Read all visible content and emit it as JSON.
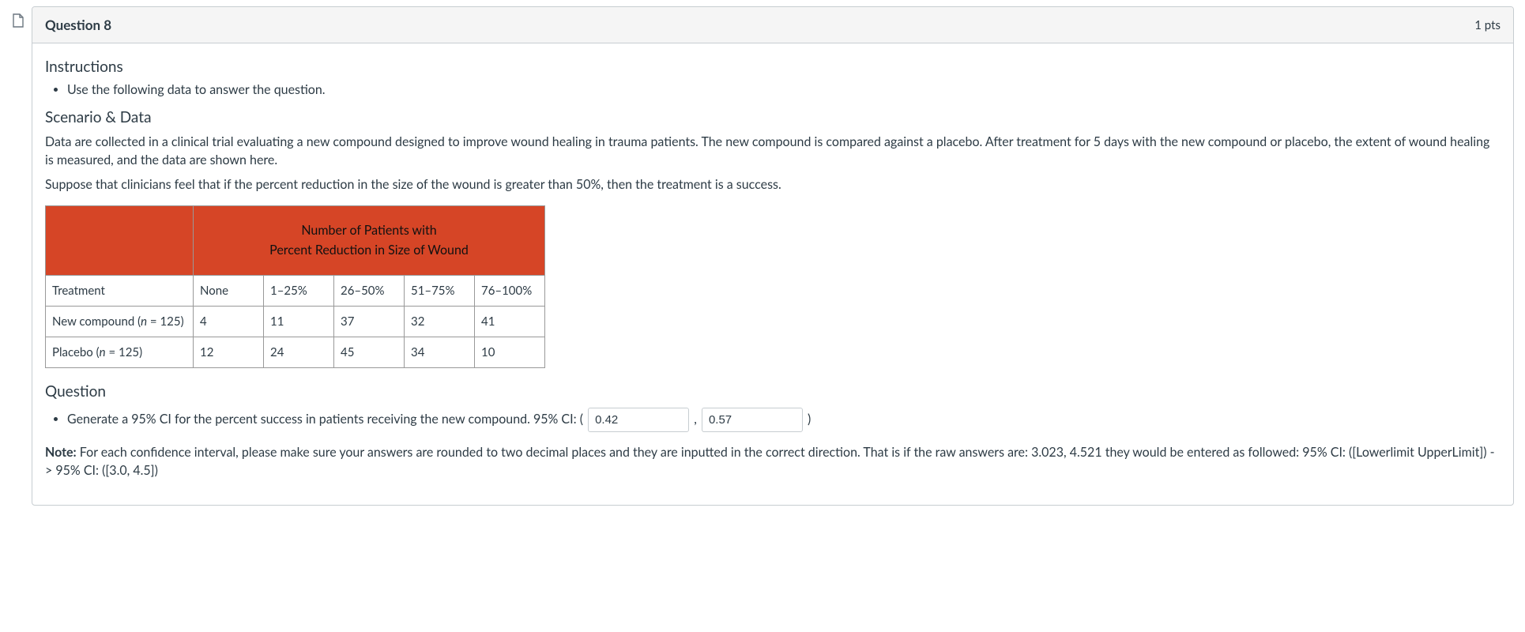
{
  "header": {
    "title": "Question 8",
    "points": "1 pts"
  },
  "sections": {
    "instructions_h": "Instructions",
    "instructions_item": "Use the following data to answer the question.",
    "scenario_h": "Scenario & Data",
    "scenario_p1": "Data are collected in a clinical trial evaluating a new compound designed to improve wound healing in trauma patients. The new compound is compared against a placebo. After treatment for 5 days with the new compound or placebo, the extent of wound healing is measured, and the data are shown here.",
    "scenario_p2": "Suppose that clinicians feel that if the percent reduction in the size of the wound is greater than 50%, then the treatment is a success.",
    "question_h": "Question",
    "question_text_a": "Generate a 95% CI for the percent success in patients receiving the new compound. 95% CI: (",
    "comma": ",",
    "close_paren": ")",
    "note_label": "Note:",
    "note_text": " For each confidence interval, please make sure your answers are rounded to two decimal places and they are inputted in the correct direction. That is if the raw answers are: 3.023, 4.521 they would be entered as followed: 95% CI: ([Lowerlimit UpperLimit])  -> 95% CI: ([3.0, 4.5])"
  },
  "table": {
    "span_line1": "Number of Patients with",
    "span_line2": "Percent Reduction in Size of Wound",
    "headers": {
      "treatment": "Treatment",
      "c1": "None",
      "c2": "1–25%",
      "c3": "26–50%",
      "c4": "51–75%",
      "c5": "76–100%"
    },
    "rows": [
      {
        "label_pre": "New compound (",
        "label_n": "n",
        "label_post": " = 125)",
        "v1": "4",
        "v2": "11",
        "v3": "37",
        "v4": "32",
        "v5": "41"
      },
      {
        "label_pre": "Placebo (",
        "label_n": "n",
        "label_post": " = 125)",
        "v1": "12",
        "v2": "24",
        "v3": "45",
        "v4": "34",
        "v5": "10"
      }
    ]
  },
  "inputs": {
    "lower": "0.42",
    "upper": "0.57"
  }
}
